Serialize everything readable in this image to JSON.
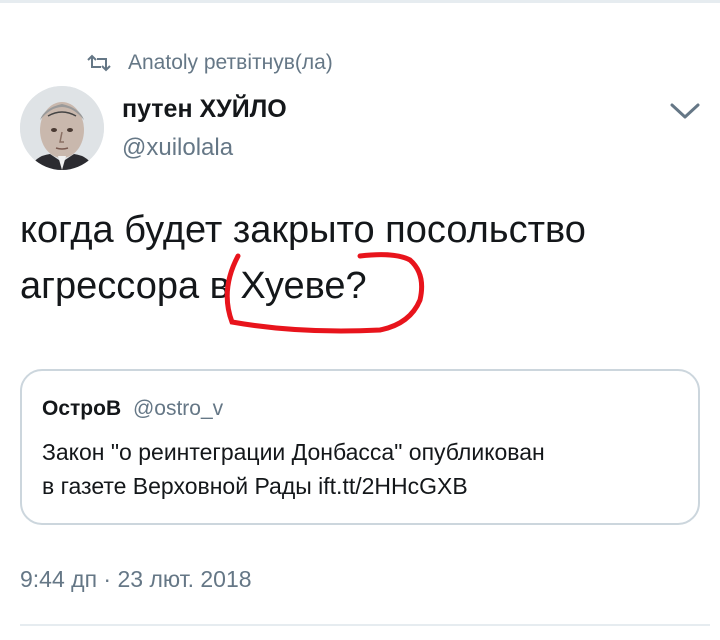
{
  "retweet": {
    "label": "Anatoly ретвітнув(ла)",
    "icon": "retweet-icon"
  },
  "tweet": {
    "author_name": "путен ХУЙЛО",
    "author_handle": "@xuilolala",
    "text_line1": "когда будет закрыто посольство",
    "text_line2_a": "агрессора",
    "text_line2_b": " в Хуеве?",
    "annotation_color": "#e8141c",
    "timestamp": "9:44 дп · 23 лют. 2018"
  },
  "quote": {
    "author_name": "ОстроВ",
    "author_handle": "@ostro_v",
    "text_line1": "Закон \"о реинтеграции Донбасса\" опубликован",
    "text_line2": "в газете Верховной Рады ift.tt/2HHcGXB"
  },
  "colors": {
    "text": "#14171a",
    "secondary": "#657786",
    "border": "#ccd6dd"
  }
}
